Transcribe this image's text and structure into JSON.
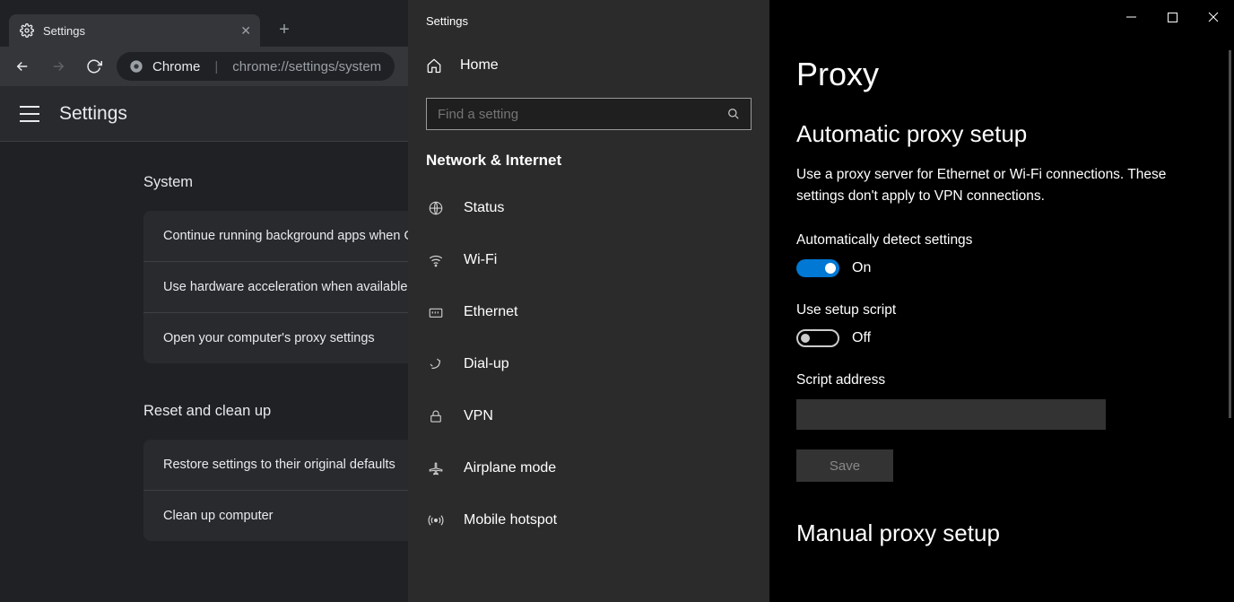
{
  "browser": {
    "tab_title": "Settings",
    "url_chip": "Chrome",
    "url_path": "chrome://settings/system"
  },
  "chrome_settings": {
    "header": "Settings",
    "sections": {
      "system": {
        "heading": "System",
        "rows": [
          "Continue running background apps when Google Chrome is closed",
          "Use hardware acceleration when available",
          "Open your computer's proxy settings"
        ]
      },
      "reset": {
        "heading": "Reset and clean up",
        "rows": [
          "Restore settings to their original defaults",
          "Clean up computer"
        ]
      }
    }
  },
  "win_sidebar": {
    "title": "Settings",
    "home": "Home",
    "search_placeholder": "Find a setting",
    "group": "Network & Internet",
    "items": [
      {
        "icon": "status",
        "label": "Status"
      },
      {
        "icon": "wifi",
        "label": "Wi-Fi"
      },
      {
        "icon": "ethernet",
        "label": "Ethernet"
      },
      {
        "icon": "dialup",
        "label": "Dial-up"
      },
      {
        "icon": "vpn",
        "label": "VPN"
      },
      {
        "icon": "airplane",
        "label": "Airplane mode"
      },
      {
        "icon": "hotspot",
        "label": "Mobile hotspot"
      }
    ]
  },
  "proxy": {
    "page_title": "Proxy",
    "auto_heading": "Automatic proxy setup",
    "auto_desc": "Use a proxy server for Ethernet or Wi-Fi connections. These settings don't apply to VPN connections.",
    "auto_detect_label": "Automatically detect settings",
    "auto_detect_state": "On",
    "setup_script_label": "Use setup script",
    "setup_script_state": "Off",
    "script_address_label": "Script address",
    "script_address_value": "",
    "save_label": "Save",
    "manual_heading": "Manual proxy setup"
  }
}
